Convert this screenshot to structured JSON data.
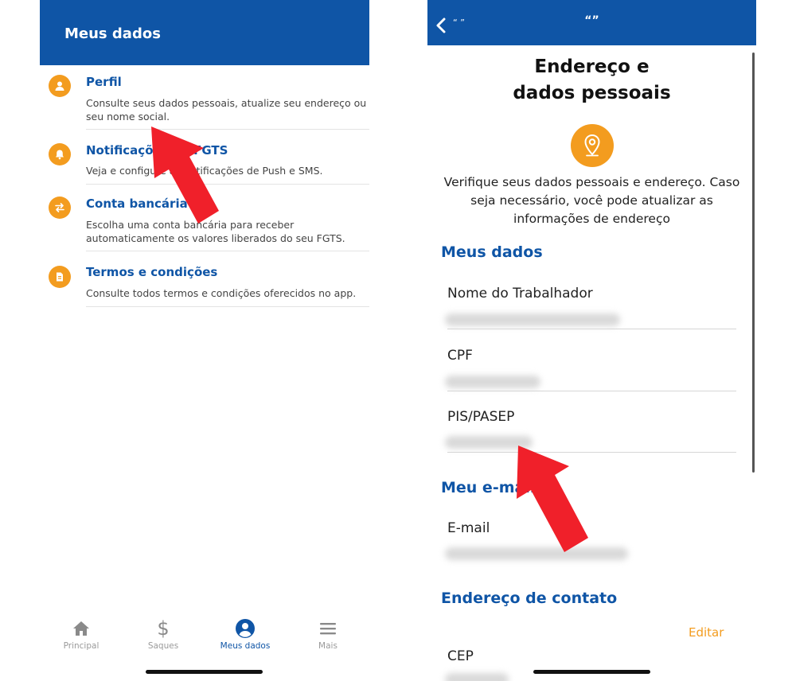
{
  "left": {
    "header_title": "Meus dados",
    "items": [
      {
        "icon": "user-icon",
        "title": "Perfil",
        "desc": "Consulte seus dados pessoais, atualize seu endereço ou seu nome social."
      },
      {
        "icon": "bell-icon",
        "title": "Notificações do FGTS",
        "desc": "Veja e configure as notificações de Push e SMS."
      },
      {
        "icon": "swap-icon",
        "title": "Conta bancária",
        "desc": "Escolha uma conta bancária para receber automaticamente os valores liberados do seu FGTS."
      },
      {
        "icon": "document-icon",
        "title": "Termos e condições",
        "desc": "Consulte todos termos e condições oferecidos no app."
      }
    ],
    "nav": [
      {
        "icon": "home-icon",
        "label": "Principal",
        "active": false
      },
      {
        "icon": "dollar-icon",
        "label": "Saques",
        "active": false
      },
      {
        "icon": "user-circle-icon",
        "label": "Meus dados",
        "active": true
      },
      {
        "icon": "menu-icon",
        "label": "Mais",
        "active": false
      }
    ]
  },
  "right": {
    "header_back_label": "“ ”",
    "header_title": "“”",
    "heading_line1": "Endereço e",
    "heading_line2": "dados pessoais",
    "intro": "Verifique seus dados pessoais e endereço. Caso seja necessário, você pode atualizar as informações de endereço",
    "section_meus_dados": "Meus dados",
    "fields": [
      {
        "label": "Nome do Trabalhador"
      },
      {
        "label": "CPF"
      },
      {
        "label": "PIS/PASEP"
      }
    ],
    "section_email": "Meu e-mail",
    "email_label": "E-mail",
    "section_endereco": "Endereço de contato",
    "edit_label": "Editar",
    "cep_label": "CEP"
  },
  "colors": {
    "brand_blue": "#0f55a6",
    "accent_orange": "#f39c1f",
    "annotation_red": "#f0202a"
  }
}
